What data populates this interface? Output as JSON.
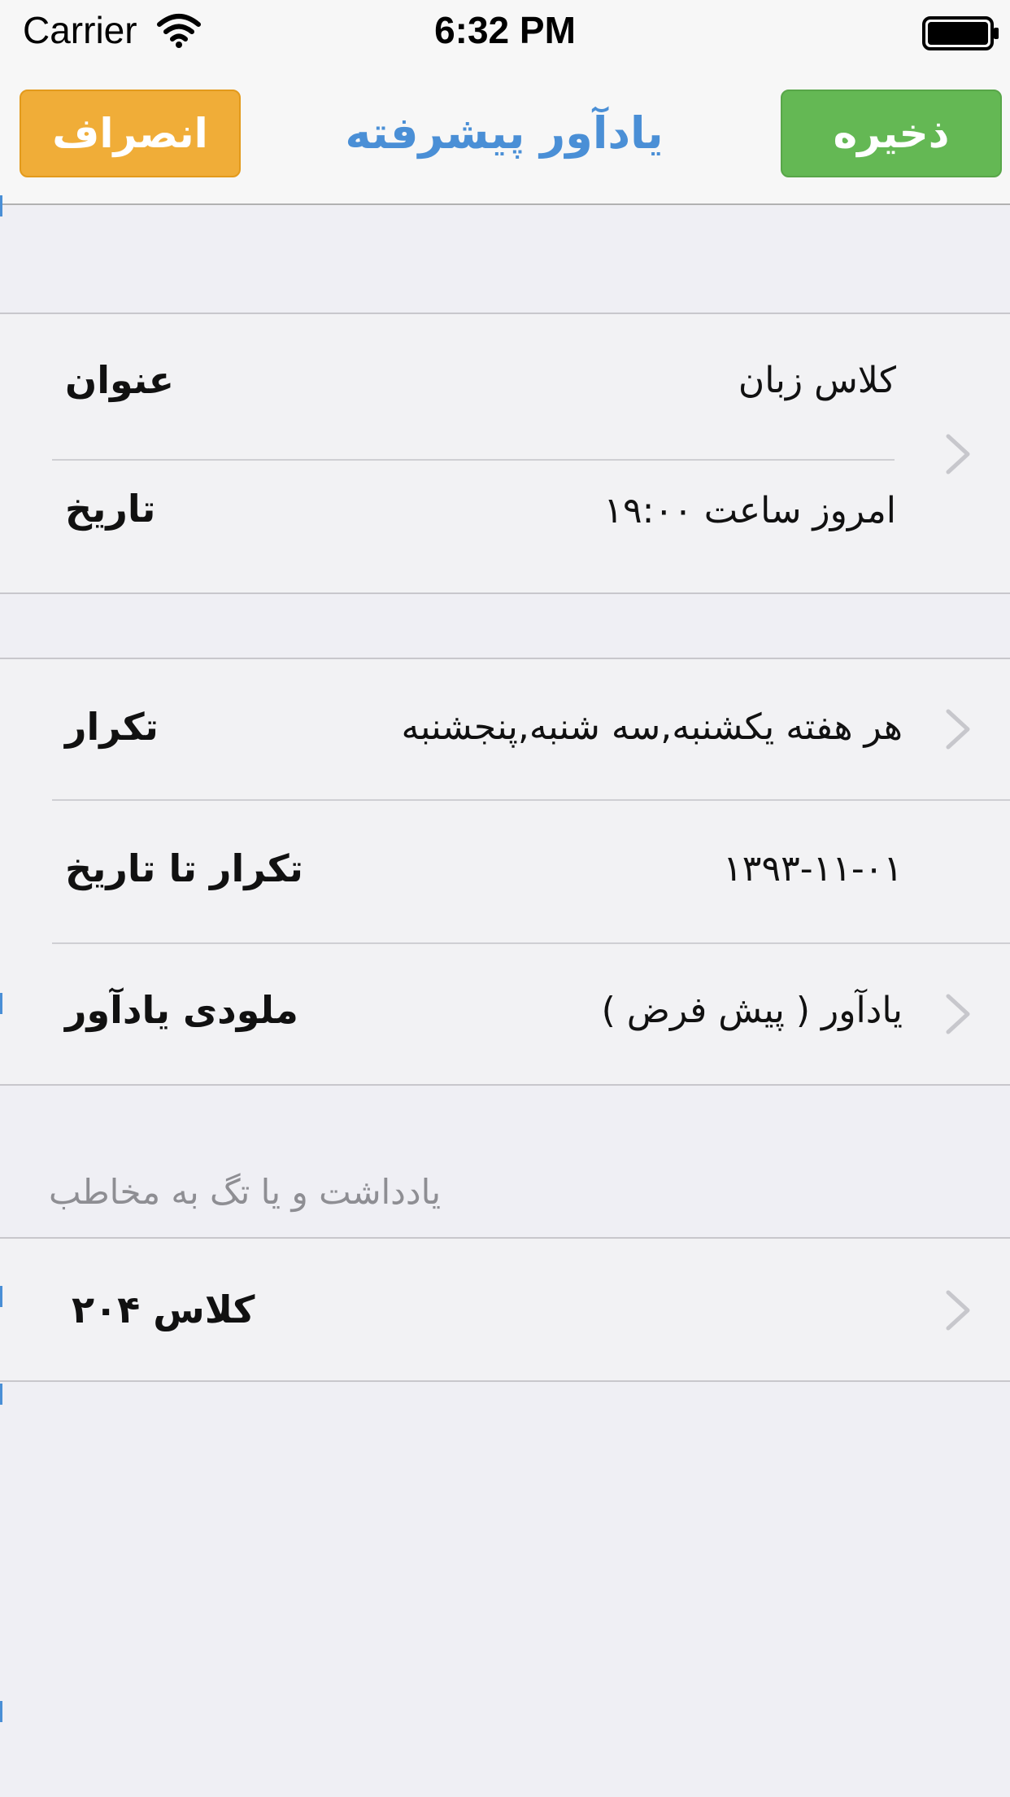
{
  "status_bar": {
    "carrier": "Carrier",
    "time": "6:32 PM",
    "icons": [
      "wifi-icon",
      "battery-icon"
    ]
  },
  "nav": {
    "cancel_label": "انصراف",
    "title": "یادآور پیشرفته",
    "save_label": "ذخیره"
  },
  "colors": {
    "background": "#efeff4",
    "cancel_button": "#f0ad38",
    "save_button": "#64b854",
    "title": "#4a8fd6",
    "section_header": "#8e8e93"
  },
  "group1": {
    "rows": [
      {
        "label": "عنوان",
        "value": "کلاس زبان"
      },
      {
        "label": "تاریخ",
        "value": "امروز ساعت ۱۹:۰۰"
      }
    ]
  },
  "group2": {
    "rows": [
      {
        "label": "تکرار",
        "value": "هر هفته یکشنبه,سه شنبه,پنجشنبه"
      },
      {
        "label": "تکرار تا تاریخ",
        "value": "۱۳۹۳-۱۱-۰۱"
      },
      {
        "label": "ملودی یادآور",
        "value": "یادآور ( پیش فرض )"
      }
    ]
  },
  "notes_section": {
    "header": "یادداشت و یا تگ به مخاطب",
    "rows": [
      {
        "value": "کلاس ۲۰۴"
      }
    ]
  }
}
